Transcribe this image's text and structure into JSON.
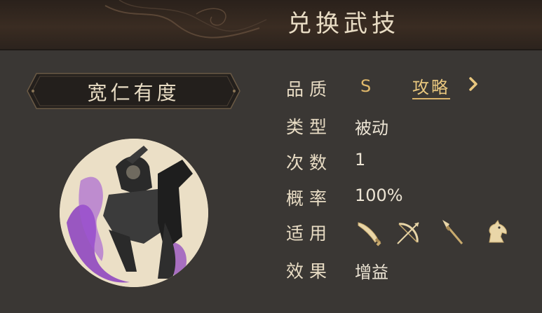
{
  "header": {
    "title": "兑换武技"
  },
  "skill": {
    "name": "宽仁有度",
    "rows": [
      {
        "label": "品质",
        "value": "S"
      },
      {
        "label": "类型",
        "value": "被动"
      },
      {
        "label": "次数",
        "value": "1"
      },
      {
        "label": "概率",
        "value": "100%"
      },
      {
        "label": "适用",
        "value": ""
      },
      {
        "label": "效果",
        "value": "增益"
      }
    ],
    "strategy_label": "攻略",
    "applicable_icons": [
      "saber-icon",
      "bow-icon",
      "spear-icon",
      "horse-icon"
    ]
  },
  "colors": {
    "accent": "#e9c77e",
    "text": "#e8dcc4",
    "panel": "#3a3734",
    "quality": "#e0b86b"
  }
}
